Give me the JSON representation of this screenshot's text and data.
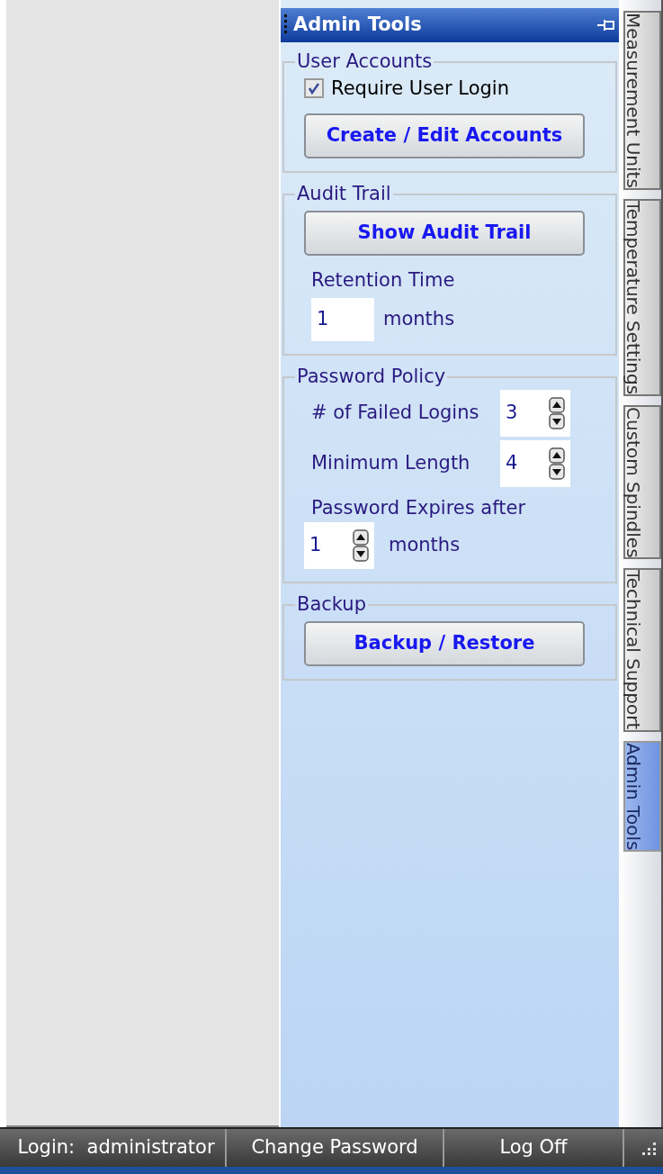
{
  "panel": {
    "title": "Admin Tools"
  },
  "groups": [
    {
      "title": "User Accounts",
      "items": [
        {
          "kind": "checkbox",
          "label": "Require User Login",
          "checked": true
        },
        {
          "kind": "button",
          "label": "Create / Edit Accounts"
        }
      ]
    },
    {
      "title": "Audit Trail",
      "items": [
        {
          "kind": "button",
          "label": "Show Audit Trail"
        },
        {
          "kind": "label",
          "label": "Retention Time"
        },
        {
          "kind": "field",
          "value": "1",
          "unit": "months"
        }
      ]
    },
    {
      "title": "Password Policy",
      "items": [
        {
          "kind": "spinner_row",
          "label": "# of Failed Logins",
          "value": "3"
        },
        {
          "kind": "spinner_row",
          "label": "Minimum Length",
          "value": "4"
        },
        {
          "kind": "label",
          "label": "Password Expires after"
        },
        {
          "kind": "spinner",
          "value": "1",
          "unit": "months"
        }
      ]
    },
    {
      "title": "Backup",
      "items": [
        {
          "kind": "button",
          "label": "Backup / Restore"
        }
      ]
    }
  ],
  "tabs": [
    {
      "label": "Measurement Units",
      "selected": false
    },
    {
      "label": "Temperature Settings",
      "selected": false
    },
    {
      "label": "Custom Spindles",
      "selected": false
    },
    {
      "label": "Technical Support",
      "selected": false
    },
    {
      "label": "Admin Tools",
      "selected": true
    }
  ],
  "status_bar": [
    "Login:  administrator",
    "Change Password",
    "Log Off"
  ]
}
